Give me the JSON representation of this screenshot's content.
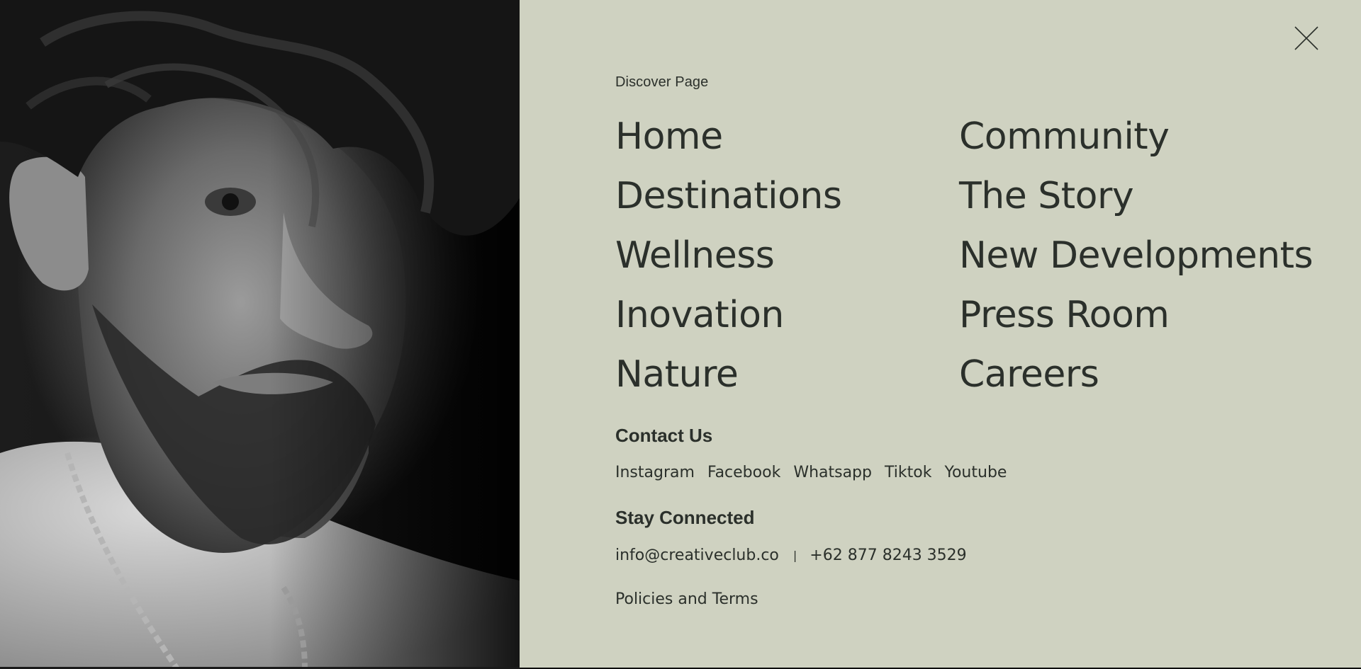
{
  "menu": {
    "close_icon": "close-icon",
    "discover_label": "Discover Page",
    "left_links": [
      "Home",
      "Destinations",
      "Wellness",
      "Inovation",
      "Nature"
    ],
    "right_links": [
      "Community",
      "The Story",
      "New Developments",
      "Press Room",
      "Careers"
    ],
    "contact_title": "Contact Us",
    "socials": [
      "Instagram",
      "Facebook",
      "Whatsapp",
      "Tiktok",
      "Youtube"
    ],
    "stay_title": "Stay Connected",
    "email": "info@creativeclub.co",
    "separator": "|",
    "phone": "+62 877 8243 3529",
    "policies": "Policies and Terms"
  },
  "colors": {
    "panel_background": "#cfd2c1",
    "text": "#2b302b",
    "photo_tone": "#1c1c1c"
  }
}
